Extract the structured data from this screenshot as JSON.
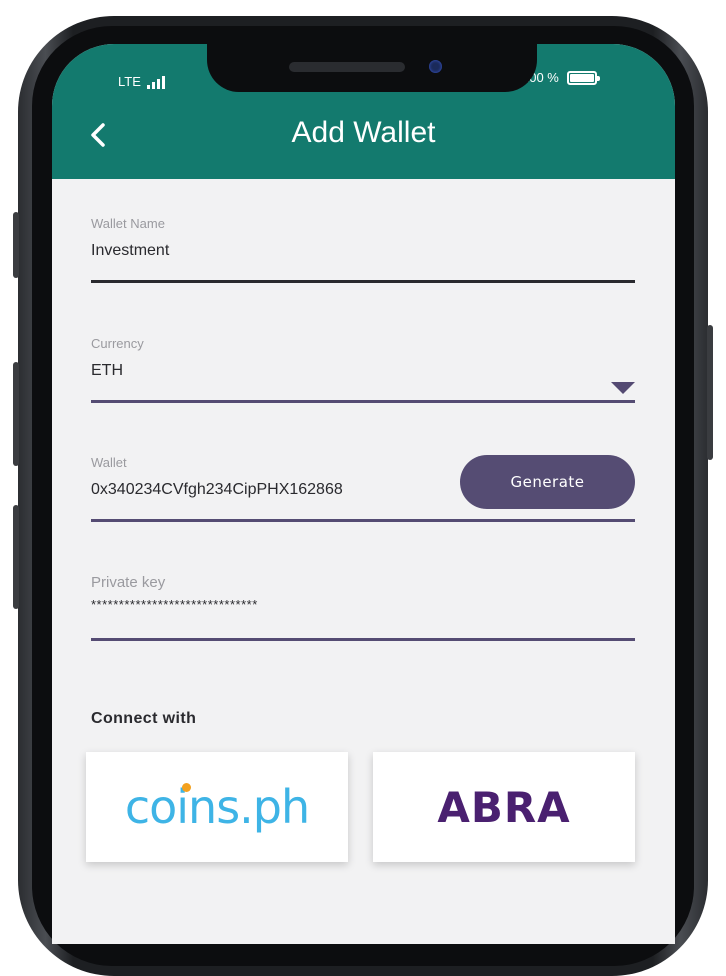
{
  "status_bar": {
    "network": "LTE",
    "battery": "100 %"
  },
  "header": {
    "title": "Add Wallet",
    "back_icon": "chevron-left-icon"
  },
  "form": {
    "wallet_name": {
      "label": "Wallet Name",
      "value": "Investment"
    },
    "currency": {
      "label": "Currency",
      "value": "ETH"
    },
    "wallet": {
      "label": "Wallet",
      "value": "0x340234CVfgh234CipPHX162868",
      "generate_label": "Generate"
    },
    "private_key": {
      "label": "Private key",
      "value": "******************************"
    }
  },
  "connect": {
    "title": "Connect with",
    "providers": [
      {
        "name": "coins.ph",
        "text": "coins.ph",
        "color": "#3eb4e6"
      },
      {
        "name": "ABRA",
        "text": "ABRA",
        "color": "#4a2070"
      }
    ]
  },
  "colors": {
    "header": "#137a6e",
    "accent": "#554c73",
    "background": "#f2f2f3"
  }
}
